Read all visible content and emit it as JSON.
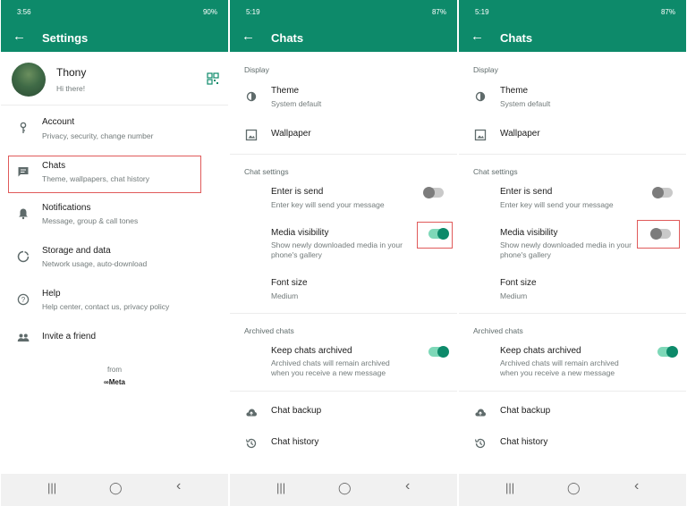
{
  "status_bars": [
    {
      "time": "3:56",
      "right": "90%"
    },
    {
      "time": "5:19",
      "right": "87%"
    },
    {
      "time": "5:19",
      "right": "87%"
    }
  ],
  "settings_screen": {
    "title": "Settings",
    "profile": {
      "name": "Thony",
      "status": "Hi there!"
    },
    "items": [
      {
        "title": "Account",
        "subtitle": "Privacy, security, change number"
      },
      {
        "title": "Chats",
        "subtitle": "Theme, wallpapers, chat history"
      },
      {
        "title": "Notifications",
        "subtitle": "Message, group & call tones"
      },
      {
        "title": "Storage and data",
        "subtitle": "Network usage, auto-download"
      },
      {
        "title": "Help",
        "subtitle": "Help center, contact us, privacy policy"
      },
      {
        "title": "Invite a friend",
        "subtitle": ""
      }
    ],
    "footer_from": "from",
    "footer_brand": "∞Meta"
  },
  "chats_screen": {
    "title": "Chats",
    "display_label": "Display",
    "theme_title": "Theme",
    "theme_value": "System default",
    "wallpaper_title": "Wallpaper",
    "chat_settings_label": "Chat settings",
    "enter_is_send_title": "Enter is send",
    "enter_is_send_sub": "Enter key will send your message",
    "media_visibility_title": "Media visibility",
    "media_visibility_sub1": "Show newly downloaded media in your",
    "media_visibility_sub2": "phone's gallery",
    "font_size_title": "Font size",
    "font_size_value": "Medium",
    "archived_label": "Archived chats",
    "keep_archived_title": "Keep chats archived",
    "keep_archived_sub1": "Archived chats will remain archived",
    "keep_archived_sub2": "when you receive a new message",
    "chat_backup_title": "Chat backup",
    "chat_history_title": "Chat history"
  },
  "toggles": {
    "screen2": {
      "enter_is_send": false,
      "media_visibility": true,
      "keep_chats_archived": true
    },
    "screen3": {
      "enter_is_send": false,
      "media_visibility": false,
      "keep_chats_archived": true
    }
  },
  "colors": {
    "brand": "#0d8a6a",
    "highlight": "#e05a5a",
    "toggle_on": "#0d8a6a"
  },
  "nav_glyphs": {
    "recents": "|||",
    "home": "◯",
    "back": "‹"
  }
}
